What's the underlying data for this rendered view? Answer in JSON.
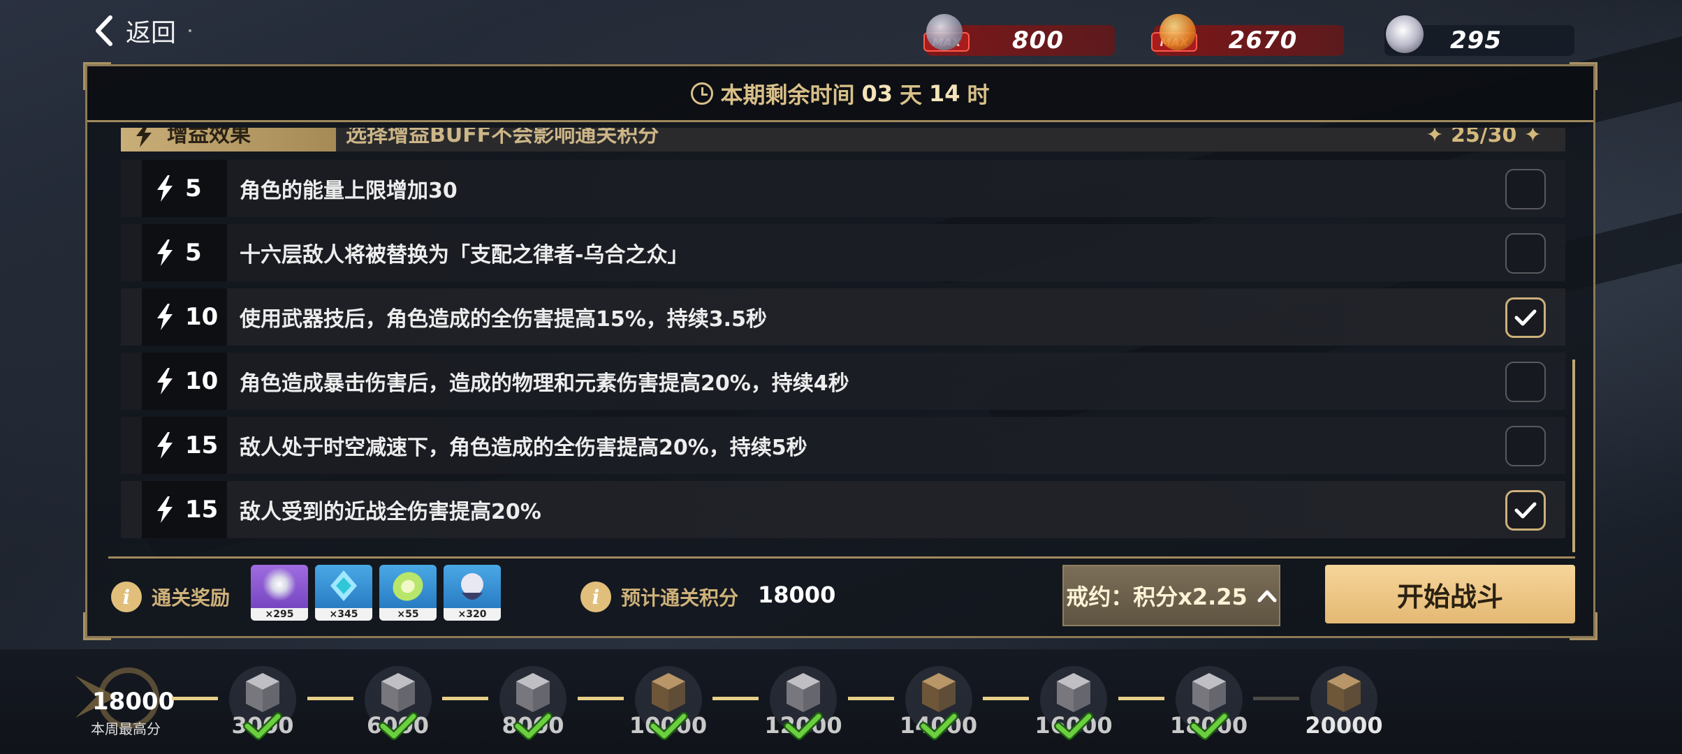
{
  "header": {
    "back_label": "返回",
    "currencies": [
      {
        "value": "800",
        "badge": "MAX",
        "icon": "crystal-icon"
      },
      {
        "value": "2670",
        "badge": "MAX",
        "icon": "gold-coin-icon"
      },
      {
        "value": "295",
        "icon": "stigmata-icon"
      }
    ]
  },
  "timer": {
    "prefix": "本期剩余时间",
    "days": "03",
    "days_unit": "天",
    "hours": "14",
    "hours_unit": "时"
  },
  "buff_section": {
    "title": "增益效果",
    "description": "选择增益BUFF不会影响通关积分",
    "count": "25/30",
    "items": [
      {
        "cost": "5",
        "text": "角色的能量上限增加30",
        "selected": false
      },
      {
        "cost": "5",
        "text": "十六层敌人将被替换为「支配之律者-乌合之众」",
        "selected": false
      },
      {
        "cost": "10",
        "text": "使用武器技后，角色造成的全伤害提高15%，持续3.5秒",
        "selected": true
      },
      {
        "cost": "10",
        "text": "角色造成暴击伤害后，造成的物理和元素伤害提高20%，持续4秒",
        "selected": false
      },
      {
        "cost": "15",
        "text": "敌人处于时空减速下，角色造成的全伤害提高20%，持续5秒",
        "selected": false
      },
      {
        "cost": "15",
        "text": "敌人受到的近战全伤害提高20%",
        "selected": true
      }
    ]
  },
  "rewards": {
    "label": "通关奖励",
    "items": [
      {
        "qty": "×295",
        "icon": "stigmata-icon"
      },
      {
        "qty": "×345",
        "icon": "blue-crystal-icon"
      },
      {
        "qty": "×55",
        "icon": "green-coin-icon"
      },
      {
        "qty": "×320",
        "icon": "valkyrie-fragment-icon"
      }
    ]
  },
  "estimate": {
    "label": "预计通关积分",
    "value": "18000"
  },
  "contract_button": {
    "label": "戒约：积分x2.25"
  },
  "start_button": {
    "label": "开始战斗"
  },
  "progress": {
    "best_score": "18000",
    "best_label": "本周最高分",
    "milestones": [
      {
        "label": "3000",
        "claimed": true
      },
      {
        "label": "6000",
        "claimed": true
      },
      {
        "label": "8000",
        "claimed": true
      },
      {
        "label": "10000",
        "claimed": true
      },
      {
        "label": "12000",
        "claimed": true
      },
      {
        "label": "14000",
        "claimed": true
      },
      {
        "label": "16000",
        "claimed": true
      },
      {
        "label": "18000",
        "claimed": true
      },
      {
        "label": "20000",
        "claimed": false
      }
    ]
  },
  "colors": {
    "gold": "#cfb27a",
    "button_gold": "#f6d59a",
    "check_green": "#6ccf3f",
    "currency_red": "#8c1414"
  }
}
